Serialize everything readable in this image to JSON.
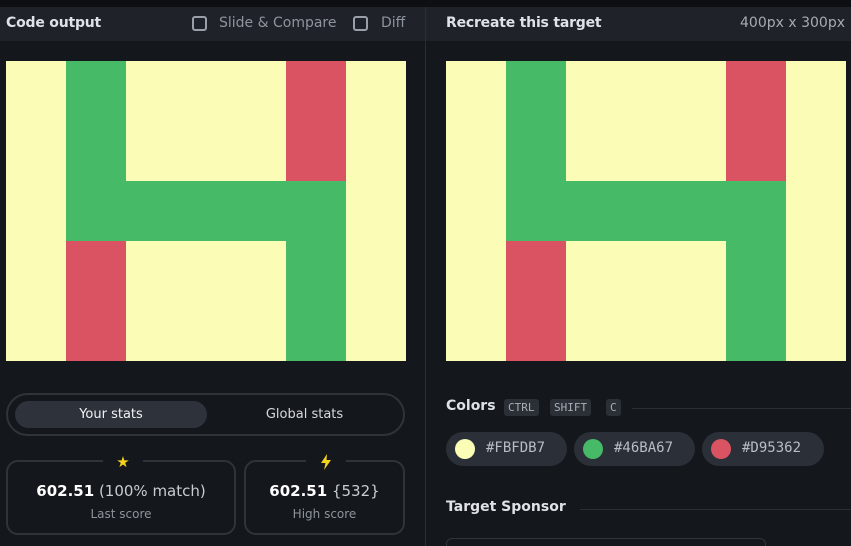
{
  "left_header": {
    "title": "Code output",
    "slide_compare_label": "Slide & Compare",
    "diff_label": "Diff"
  },
  "right_header": {
    "title": "Recreate this target",
    "dimensions": "400px x 300px"
  },
  "stats_toggle": {
    "your_stats": "Your stats",
    "global_stats": "Global stats"
  },
  "last_score": {
    "icon": "star-icon",
    "score": "602.51",
    "detail": "(100% match)",
    "label": "Last score"
  },
  "high_score": {
    "icon": "lightning-icon",
    "score": "602.51",
    "detail": "{532}",
    "label": "High score"
  },
  "colors_section": {
    "title": "Colors",
    "shortcut_keys": [
      "CTRL",
      "SHIFT",
      "C"
    ],
    "swatches": [
      {
        "hex": "#FBFDB7",
        "color": "#FBFDB7"
      },
      {
        "hex": "#46BA67",
        "color": "#46BA67"
      },
      {
        "hex": "#D95362",
        "color": "#D95362"
      }
    ]
  },
  "sponsor_section": {
    "title": "Target Sponsor"
  },
  "palette": {
    "yellow": "#FBFDB7",
    "green": "#46BA67",
    "red": "#D95362"
  }
}
